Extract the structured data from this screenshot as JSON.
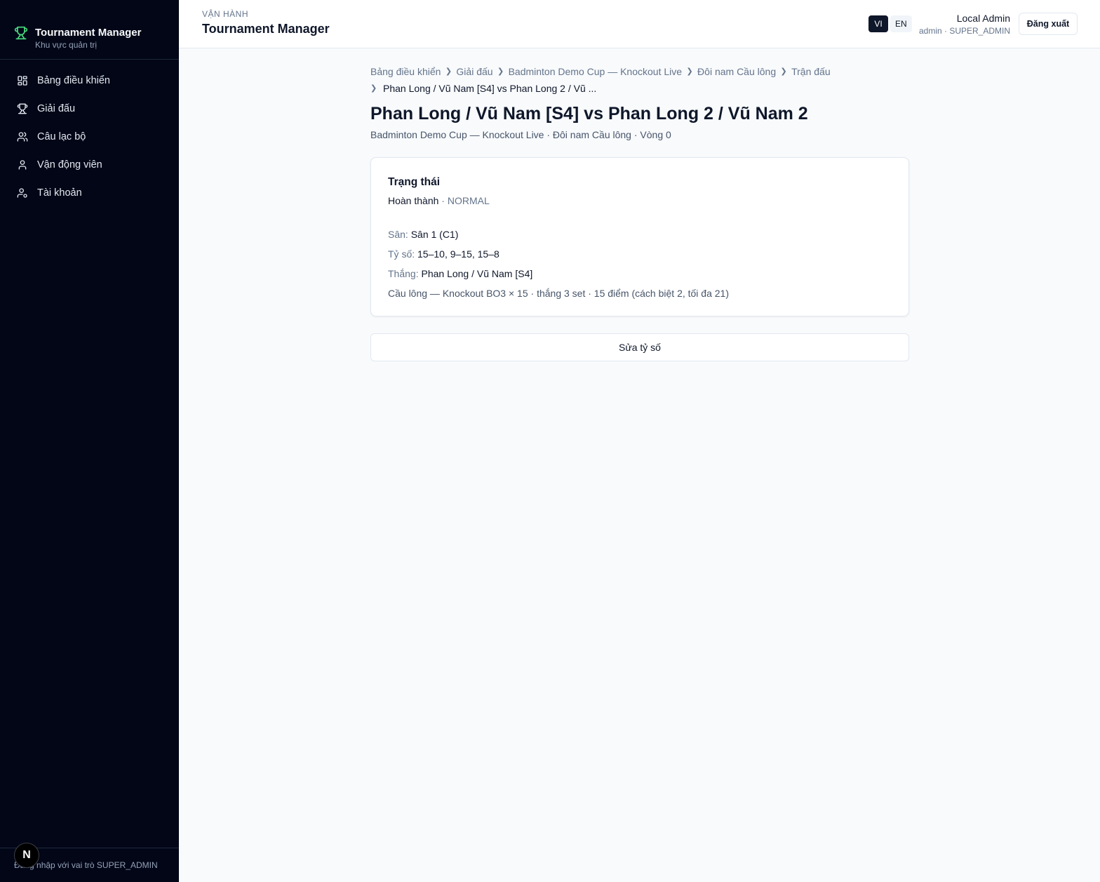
{
  "sidebar": {
    "brand_title": "Tournament Manager",
    "brand_subtitle": "Khu vực quản trị",
    "items": [
      {
        "label": "Bảng điều khiển",
        "icon": "dashboard-icon"
      },
      {
        "label": "Giải đấu",
        "icon": "trophy-icon"
      },
      {
        "label": "Câu lạc bộ",
        "icon": "users-icon"
      },
      {
        "label": "Vận động viên",
        "icon": "user-icon"
      },
      {
        "label": "Tài khoản",
        "icon": "user-cog-icon"
      }
    ],
    "footer": "Đăng nhập với vai trò SUPER_ADMIN",
    "badge": "N"
  },
  "header": {
    "eyebrow": "VẬN HÀNH",
    "title": "Tournament Manager",
    "lang_vi": "VI",
    "lang_en": "EN",
    "user_name": "Local Admin",
    "user_role": "admin · SUPER_ADMIN",
    "logout_label": "Đăng xuất"
  },
  "breadcrumb": {
    "items": [
      "Bảng điều khiển",
      "Giải đấu",
      "Badminton Demo Cup — Knockout Live",
      "Đôi nam Cầu lông",
      "Trận đấu"
    ],
    "current": "Phan Long / Vũ Nam [S4] vs Phan Long 2 / Vũ ..."
  },
  "page": {
    "title": "Phan Long / Vũ Nam [S4] vs Phan Long 2 / Vũ Nam 2",
    "subtitle": "Badminton Demo Cup — Knockout Live · Đôi nam Cầu lông · Vòng 0"
  },
  "card": {
    "title": "Trạng thái",
    "status": "Hoàn thành",
    "status_sep": " · ",
    "mode": "NORMAL",
    "court_label": "Sân:",
    "court_value": "Sân 1 (C1)",
    "score_label": "Tỷ số:",
    "score_value": "15–10, 9–15, 15–8",
    "winner_label": "Thắng:",
    "winner_value": "Phan Long / Vũ Nam [S4]",
    "format": "Cầu lông — Knockout BO3 × 15 · thắng 3 set · 15 điểm (cách biệt 2, tối đa 21)"
  },
  "actions": {
    "edit_score": "Sửa tỷ số"
  },
  "colors": {
    "sidebar_bg": "#020617",
    "accent": "#4ade80",
    "page_bg": "#f8fafc"
  }
}
